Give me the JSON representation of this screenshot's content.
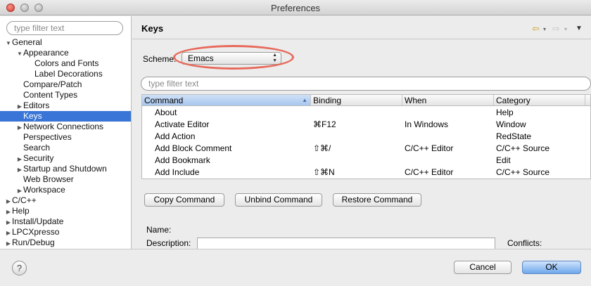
{
  "window": {
    "title": "Preferences"
  },
  "tree_filter": {
    "placeholder": "type filter text"
  },
  "tree": [
    {
      "label": "General",
      "arrow": "▼"
    },
    {
      "label": "Appearance",
      "arrow": "▼"
    },
    {
      "label": "Colors and Fonts",
      "arrow": ""
    },
    {
      "label": "Label Decorations",
      "arrow": ""
    },
    {
      "label": "Compare/Patch",
      "arrow": ""
    },
    {
      "label": "Content Types",
      "arrow": ""
    },
    {
      "label": "Editors",
      "arrow": "▶"
    },
    {
      "label": "Keys",
      "arrow": "",
      "selected": true
    },
    {
      "label": "Network Connections",
      "arrow": "▶"
    },
    {
      "label": "Perspectives",
      "arrow": ""
    },
    {
      "label": "Search",
      "arrow": ""
    },
    {
      "label": "Security",
      "arrow": "▶"
    },
    {
      "label": "Startup and Shutdown",
      "arrow": "▶"
    },
    {
      "label": "Web Browser",
      "arrow": ""
    },
    {
      "label": "Workspace",
      "arrow": "▶"
    },
    {
      "label": "C/C++",
      "arrow": "▶"
    },
    {
      "label": "Help",
      "arrow": "▶"
    },
    {
      "label": "Install/Update",
      "arrow": "▶"
    },
    {
      "label": "LPCXpresso",
      "arrow": "▶"
    },
    {
      "label": "Run/Debug",
      "arrow": "▶"
    }
  ],
  "page": {
    "title": "Keys",
    "nav": {
      "back_icon": "⇦",
      "forward_icon": "⇨",
      "dropdown_icon": "▾",
      "menu_icon": "▼"
    }
  },
  "scheme": {
    "label": "Scheme:",
    "value": "Emacs"
  },
  "command_filter": {
    "placeholder": "type filter text"
  },
  "table": {
    "columns": [
      "Command",
      "Binding",
      "When",
      "Category"
    ],
    "rows": [
      {
        "command": "About",
        "binding": "",
        "when": "",
        "category": "Help"
      },
      {
        "command": "Activate Editor",
        "binding": "⌘F12",
        "when": "In Windows",
        "category": "Window"
      },
      {
        "command": "Add Action",
        "binding": "",
        "when": "",
        "category": "RedState"
      },
      {
        "command": "Add Block Comment",
        "binding": "⇧⌘/",
        "when": "C/C++ Editor",
        "category": "C/C++ Source"
      },
      {
        "command": "Add Bookmark",
        "binding": "",
        "when": "",
        "category": "Edit"
      },
      {
        "command": "Add Include",
        "binding": "⇧⌘N",
        "when": "C/C++ Editor",
        "category": "C/C++ Source"
      }
    ]
  },
  "buttons": {
    "copy": "Copy Command",
    "unbind": "Unbind Command",
    "restore": "Restore Command",
    "cancel": "Cancel",
    "ok": "OK",
    "help": "?"
  },
  "details": {
    "name_label": "Name:",
    "description_label": "Description:",
    "conflicts_label": "Conflicts:"
  },
  "colors": {
    "selection": "#3875d7",
    "annotation": "#e76a5b",
    "ok_button": "#6ea7ec"
  }
}
